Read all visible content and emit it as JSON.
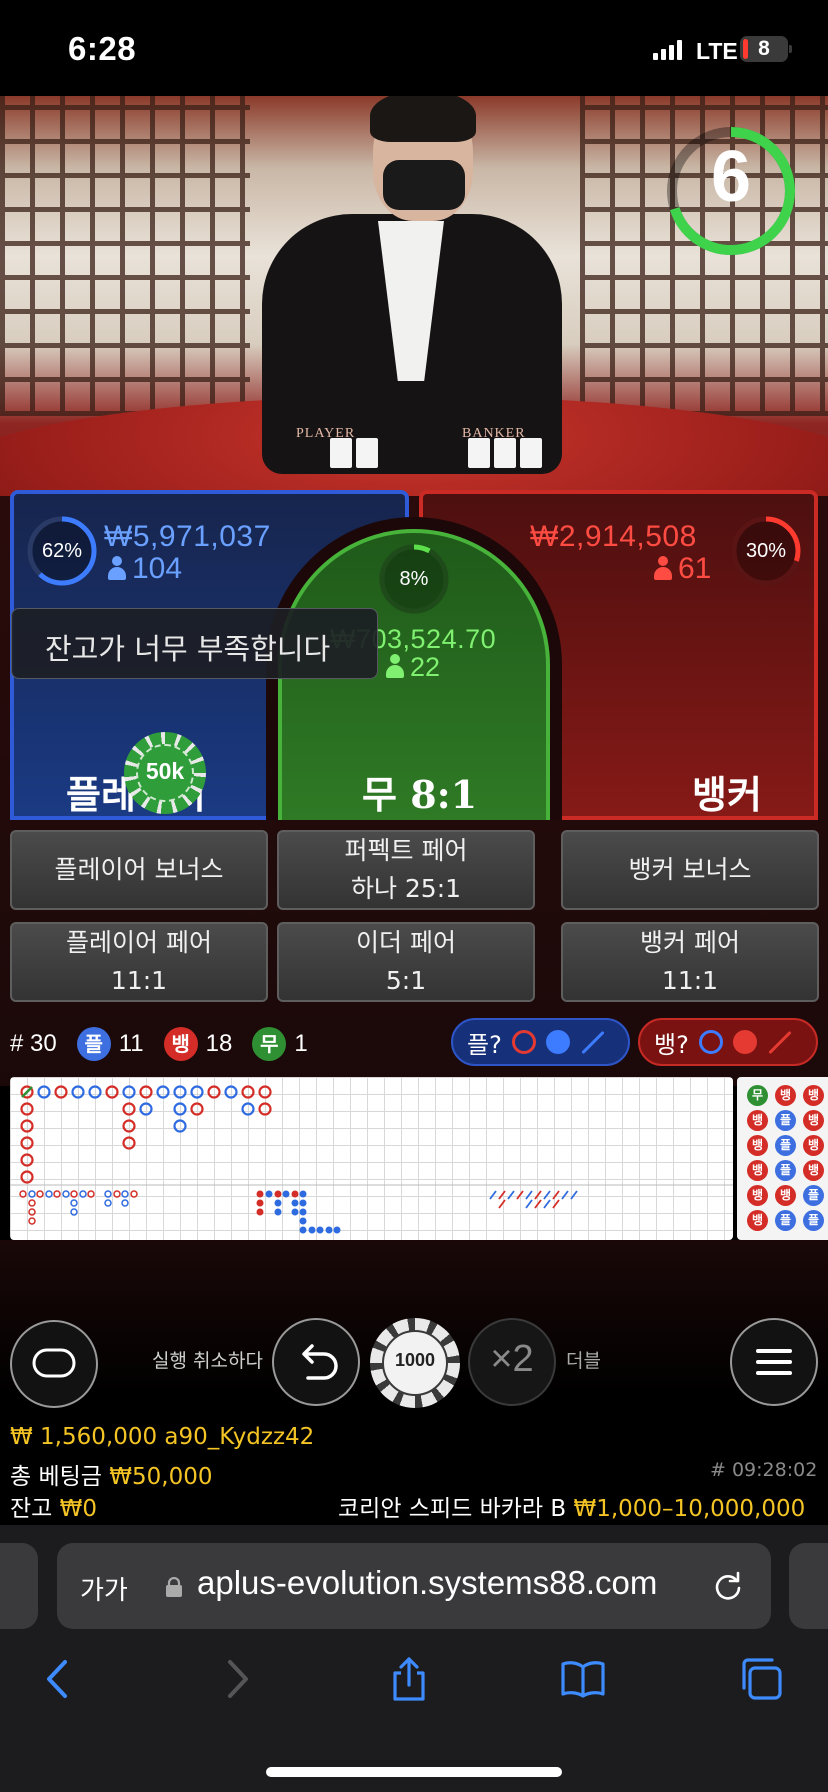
{
  "status_bar": {
    "time": "6:28",
    "network": "LTE",
    "battery": "8"
  },
  "video": {
    "countdown": "6",
    "felt_player": "PLAYER",
    "felt_banker": "BANKER"
  },
  "bets": {
    "player": {
      "percent": "62%",
      "amount": "₩5,971,037",
      "players": "104",
      "label": "플레이어",
      "percent_value": 0.62
    },
    "tie": {
      "percent": "8%",
      "amount": "₩703,524.70",
      "players": "22",
      "label": "무 8:1",
      "percent_value": 0.08
    },
    "banker": {
      "percent": "30%",
      "amount": "₩2,914,508",
      "players": "61",
      "label": "뱅커",
      "percent_value": 0.3
    },
    "placed_chip": "50k",
    "toast": "잔고가 너무 부족합니다"
  },
  "side_bets": {
    "player_bonus": "플레이어 보너스",
    "perfect_pair_line1": "퍼펙트 페어",
    "perfect_pair_line2": "하나 25:1",
    "banker_bonus": "뱅커 보너스",
    "player_pair_line1": "플레이어 페어",
    "player_pair_line2": "11:1",
    "either_pair_line1": "이더 페어",
    "either_pair_line2": "5:1",
    "banker_pair_line1": "뱅커 페어",
    "banker_pair_line2": "11:1"
  },
  "stats": {
    "round": "# 30",
    "player_badge": "플",
    "player_count": "11",
    "banker_badge": "뱅",
    "banker_count": "18",
    "tie_badge": "무",
    "tie_count": "1",
    "player_predict": "플?",
    "banker_predict": "뱅?"
  },
  "bead_road": [
    [
      "무",
      "뱅",
      "뱅"
    ],
    [
      "뱅",
      "플",
      "뱅"
    ],
    [
      "뱅",
      "플",
      "뱅"
    ],
    [
      "뱅",
      "플",
      "뱅"
    ],
    [
      "뱅",
      "뱅",
      "플"
    ],
    [
      "뱅",
      "플",
      "플"
    ]
  ],
  "controls": {
    "undo_label": "실행 취소하다",
    "chip_value": "1000",
    "double_symbol": "×2",
    "double_label": "더블"
  },
  "info": {
    "user_balance": "₩ 1,560,000",
    "username": "a90_Kydzz42",
    "total_bet_label": "총 베팅금",
    "total_bet": "₩50,000",
    "balance_label": "잔고",
    "balance": "₩0",
    "time_id": "# 09:28:02",
    "table_name": "코리안 스피드 바카라 B",
    "limits": "₩1,000–10,000,000"
  },
  "browser": {
    "aa": "가가",
    "url": "aplus-evolution.systems88.com"
  },
  "colors": {
    "player": "#2f5bd8",
    "banker": "#cc2a25",
    "tie": "#48b33a",
    "gold": "#f4c425"
  }
}
